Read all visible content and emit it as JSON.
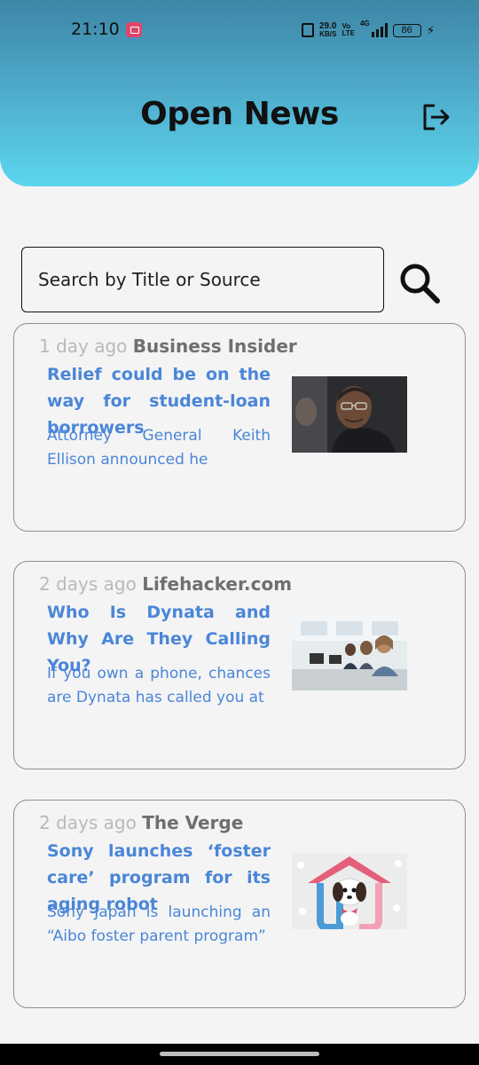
{
  "status_bar": {
    "time": "21:10",
    "net_speed_value": "29.0",
    "net_speed_unit": "KB/S",
    "volte_top": "Vo",
    "volte_bottom": "LTE",
    "network_type": "4G",
    "battery": "86"
  },
  "header": {
    "title": "Open News",
    "logout_icon": "logout-icon"
  },
  "search": {
    "placeholder": "Search by Title or Source",
    "icon": "search-icon"
  },
  "articles": [
    {
      "time": "1 day ago",
      "source": "Business Insider",
      "title": "Relief could be on the way for student-loan borrowers",
      "description": "Attorney General Keith Ellison announced he"
    },
    {
      "time": "2 days ago",
      "source": "Lifehacker.com",
      "title": "Who Is Dynata and Why Are They Calling You?",
      "description": "If you own a phone, chances are Dynata has called you at"
    },
    {
      "time": "2 days ago",
      "source": "The Verge",
      "title": "Sony launches ‘foster care’ program for its aging robot",
      "description": "Sony Japan is launching an “Aibo foster parent program”"
    }
  ],
  "colors": {
    "header_top": "#3d86a6",
    "header_bottom": "#5bd6ee",
    "link_blue": "#4a86d8",
    "background": "#f4f4f4"
  }
}
